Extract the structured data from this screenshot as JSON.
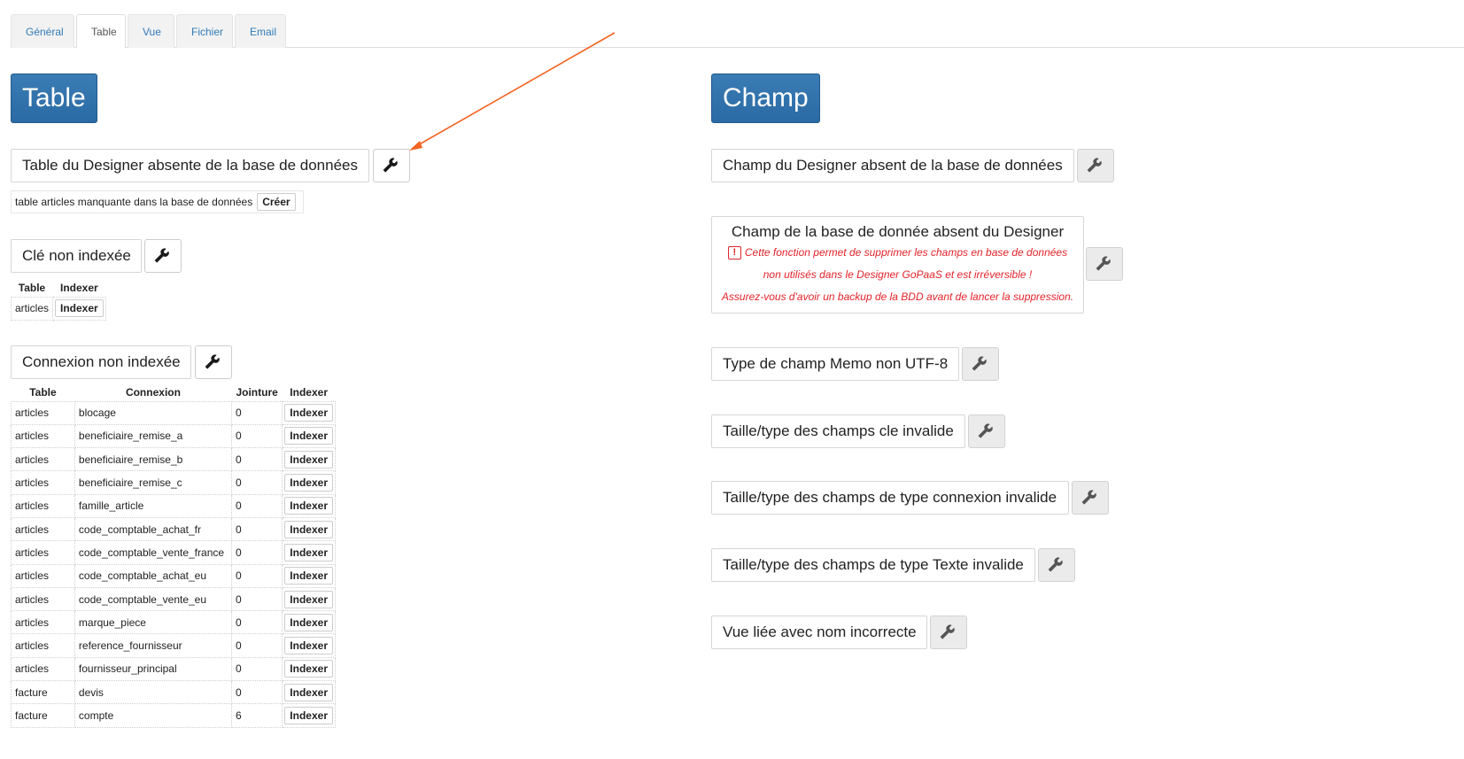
{
  "tabs": [
    {
      "label": "Général"
    },
    {
      "label": "Table"
    },
    {
      "label": "Vue"
    },
    {
      "label": "Fichier"
    },
    {
      "label": "Email"
    }
  ],
  "table_section": {
    "title": "Table",
    "missing_in_db": {
      "label": "Table du Designer absente de la base de données",
      "message": "table articles manquante dans la base de données",
      "button": "Créer"
    },
    "key_not_indexed": {
      "label": "Clé non indexée",
      "headers": [
        "Table",
        "Indexer"
      ],
      "rows": [
        {
          "table": "articles",
          "button": "Indexer"
        }
      ]
    },
    "connection_not_indexed": {
      "label": "Connexion non indexée",
      "headers": [
        "Table",
        "Connexion",
        "Jointure",
        "Indexer"
      ],
      "button_label": "Indexer",
      "rows": [
        {
          "table": "articles",
          "connexion": "blocage",
          "jointure": "0"
        },
        {
          "table": "articles",
          "connexion": "beneficiaire_remise_a",
          "jointure": "0"
        },
        {
          "table": "articles",
          "connexion": "beneficiaire_remise_b",
          "jointure": "0"
        },
        {
          "table": "articles",
          "connexion": "beneficiaire_remise_c",
          "jointure": "0"
        },
        {
          "table": "articles",
          "connexion": "famille_article",
          "jointure": "0"
        },
        {
          "table": "articles",
          "connexion": "code_comptable_achat_fr",
          "jointure": "0"
        },
        {
          "table": "articles",
          "connexion": "code_comptable_vente_france",
          "jointure": "0"
        },
        {
          "table": "articles",
          "connexion": "code_comptable_achat_eu",
          "jointure": "0"
        },
        {
          "table": "articles",
          "connexion": "code_comptable_vente_eu",
          "jointure": "0"
        },
        {
          "table": "articles",
          "connexion": "marque_piece",
          "jointure": "0"
        },
        {
          "table": "articles",
          "connexion": "reference_fournisseur",
          "jointure": "0"
        },
        {
          "table": "articles",
          "connexion": "fournisseur_principal",
          "jointure": "0"
        },
        {
          "table": "facture",
          "connexion": "devis",
          "jointure": "0"
        },
        {
          "table": "facture",
          "connexion": "compte",
          "jointure": "6"
        }
      ]
    }
  },
  "champ_section": {
    "title": "Champ",
    "items": [
      {
        "label": "Champ du Designer absent de la base de données"
      },
      {
        "label": "Champ de la base de donnée absent du Designer",
        "warning_lines": [
          "Cette fonction permet de supprimer les champs en base de données",
          "non utilisés dans le Designer GoPaaS et est irréversible !",
          "Assurez-vous d'avoir un backup de la BDD avant de lancer la suppression."
        ],
        "warning_icon": "!"
      },
      {
        "label": "Type de champ Memo non UTF-8"
      },
      {
        "label": "Taille/type des champs cle invalide"
      },
      {
        "label": "Taille/type des champs de type connexion invalide"
      },
      {
        "label": "Taille/type des champs de type Texte invalide"
      },
      {
        "label": "Vue liée avec nom incorrecte"
      }
    ]
  },
  "colors": {
    "header_bg": "#2b6aa4",
    "tab_link": "#337ab7",
    "warning": "#e3232a",
    "annotation_arrow": "#f26522"
  },
  "icons": {
    "wrench": "wrench-icon",
    "warning": "warning-icon"
  }
}
